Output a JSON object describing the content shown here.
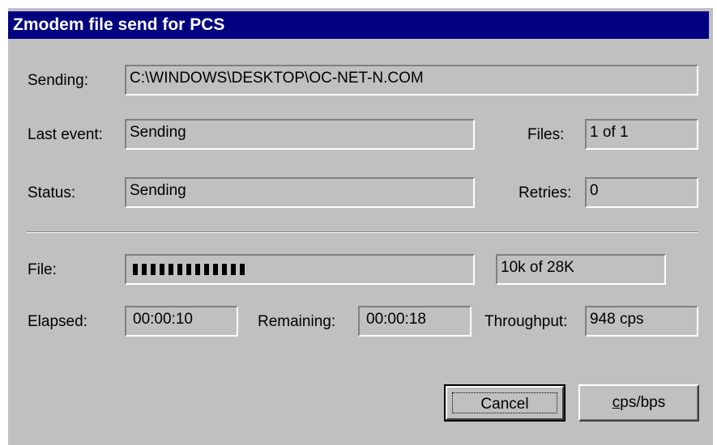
{
  "window": {
    "title": "Zmodem file send for PCS"
  },
  "sending": {
    "label": "Sending:",
    "value": "C:\\WINDOWS\\DESKTOP\\OC-NET-N.COM"
  },
  "last_event": {
    "label": "Last event:",
    "value": "Sending"
  },
  "files": {
    "label": "Files:",
    "value": "1 of 1"
  },
  "status": {
    "label": "Status:",
    "value": "Sending"
  },
  "retries": {
    "label": "Retries:",
    "value": "0"
  },
  "file": {
    "label": "File:",
    "progress_fraction": 0.357,
    "size_text": "10k of 28K"
  },
  "elapsed": {
    "label": "Elapsed:",
    "value": "00:00:10"
  },
  "remaining": {
    "label": "Remaining:",
    "value": "00:00:18"
  },
  "throughput": {
    "label": "Throughput:",
    "value": "948 cps"
  },
  "buttons": {
    "cancel": "Cancel",
    "cpsbps_first": "c",
    "cpsbps_rest": "ps/bps"
  },
  "colors": {
    "titlebar": "#000080",
    "dialog_bg": "#c0c0c0"
  }
}
